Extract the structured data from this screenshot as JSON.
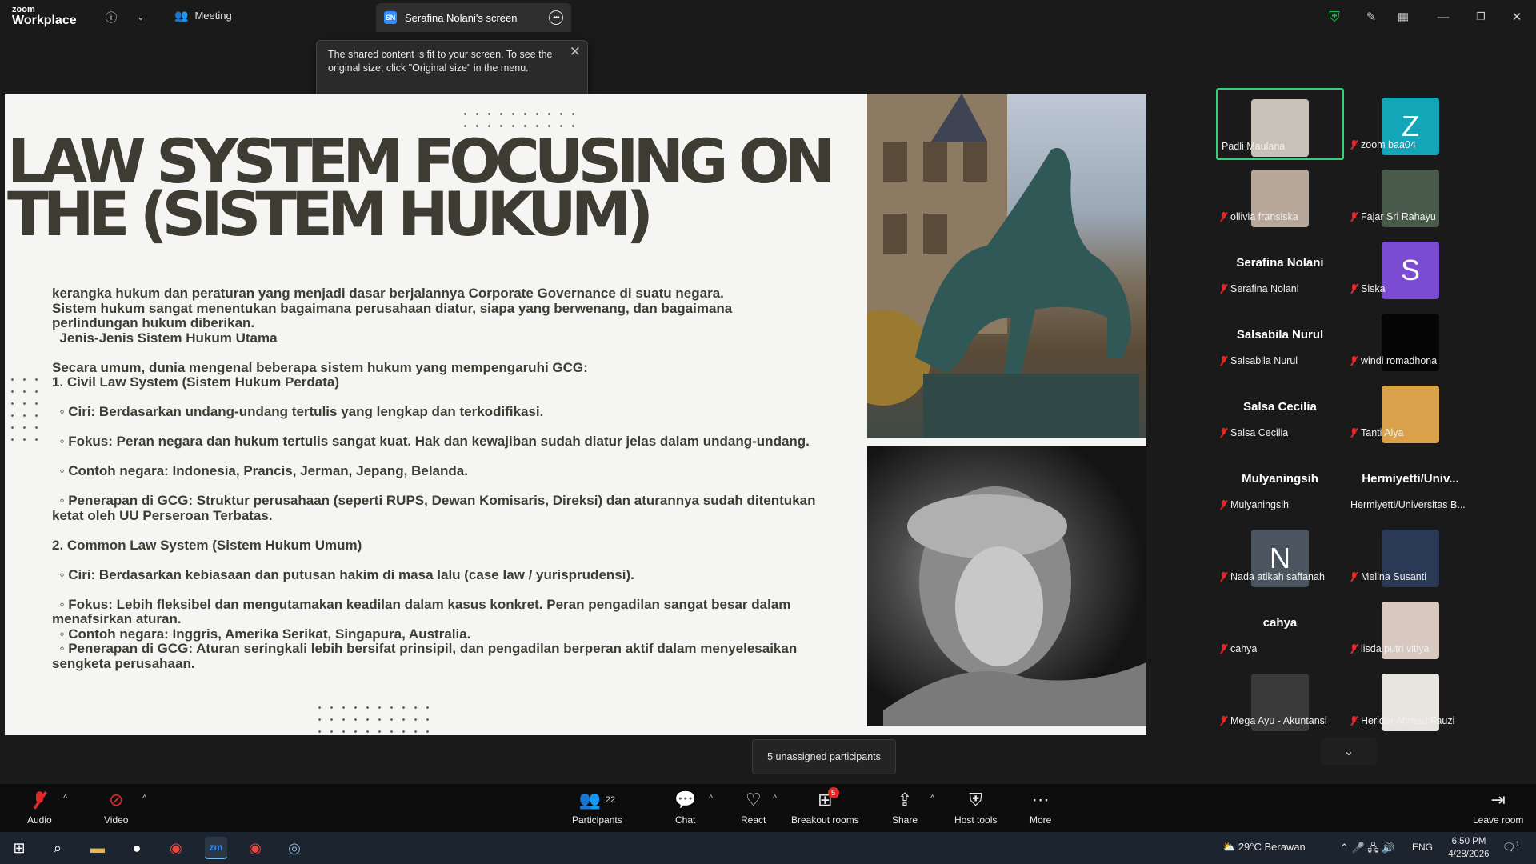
{
  "app": {
    "logo_line1": "zoom",
    "logo_line2": "Workplace",
    "meeting_tab": "Meeting",
    "share_tab": "Serafina Nolani's screen",
    "share_badge": "SN"
  },
  "tooltip": {
    "text": "The shared content is fit to your screen. To see the original size, click \"Original size\" in the menu."
  },
  "slide": {
    "title": "LAW SYSTEM FOCUSING ON THE (SISTEM HUKUM)",
    "lines": [
      "kerangka hukum dan peraturan yang menjadi dasar berjalannya Corporate Governance di suatu negara.",
      "Sistem hukum sangat menentukan bagaimana perusahaan diatur, siapa yang berwenang, dan bagaimana perlindungan hukum diberikan.",
      "  Jenis-Jenis Sistem Hukum Utama",
      "",
      "Secara umum, dunia mengenal beberapa sistem hukum yang mempengaruhi GCG:",
      "1. Civil Law System (Sistem Hukum Perdata)",
      "",
      "  ◦ Ciri: Berdasarkan undang-undang tertulis yang lengkap dan terkodifikasi.",
      "",
      "  ◦ Fokus: Peran negara dan hukum tertulis sangat kuat. Hak dan kewajiban sudah diatur jelas dalam undang-undang.",
      "",
      "  ◦ Contoh negara: Indonesia, Prancis, Jerman, Jepang, Belanda.",
      "",
      "  ◦ Penerapan di GCG: Struktur perusahaan (seperti RUPS, Dewan Komisaris, Direksi) dan aturannya sudah ditentukan ketat oleh UU Perseroan Terbatas.",
      "",
      "2. Common Law System (Sistem Hukum Umum)",
      "",
      "  ◦ Ciri: Berdasarkan kebiasaan dan putusan hakim di masa lalu (case law / yurisprudensi).",
      "",
      "  ◦ Fokus: Lebih fleksibel dan mengutamakan keadilan dalam kasus konkret. Peran pengadilan sangat besar dalam menafsirkan aturan.",
      "  ◦ Contoh negara: Inggris, Amerika Serikat, Singapura, Australia.",
      "  ◦ Penerapan di GCG: Aturan seringkali lebih bersifat prinsipil, dan pengadilan berperan aktif dalam menyelesaikan sengketa perusahaan."
    ]
  },
  "participants": [
    {
      "label": "Padli Maulana",
      "type": "photo",
      "color": "#c9c2b8",
      "active": true,
      "muted": false
    },
    {
      "label": "zoom baa04",
      "type": "letter",
      "letter": "Z",
      "color": "#13a6b8",
      "muted": true
    },
    {
      "label": "ollivia fransiska",
      "type": "photo",
      "color": "#b8a89a",
      "muted": true
    },
    {
      "label": "Fajar Sri Rahayu",
      "type": "photo",
      "color": "#4a5a4a",
      "muted": true
    },
    {
      "label": "Serafina Nolani",
      "type": "name",
      "bigname": "Serafina Nolani",
      "muted": true
    },
    {
      "label": "Siska",
      "type": "letter",
      "letter": "S",
      "color": "#7b4bd1",
      "muted": true
    },
    {
      "label": "Salsabila Nurul",
      "type": "name",
      "bigname": "Salsabila Nurul",
      "muted": true
    },
    {
      "label": "windi romadhona",
      "type": "photo",
      "color": "#050505",
      "muted": true
    },
    {
      "label": "Salsa Cecilia",
      "type": "name",
      "bigname": "Salsa Cecilia",
      "muted": true
    },
    {
      "label": "Tanti Alya",
      "type": "photo",
      "color": "#d9a14a",
      "muted": true
    },
    {
      "label": "Mulyaningsih",
      "type": "name",
      "bigname": "Mulyaningsih",
      "muted": true
    },
    {
      "label": "Hermiyetti/Universitas B...",
      "type": "name",
      "bigname": "Hermiyetti/Univ...",
      "muted": false
    },
    {
      "label": "Nada atikah saffanah",
      "type": "letter",
      "letter": "N",
      "color": "#4a5560",
      "muted": true
    },
    {
      "label": "Melina Susanti",
      "type": "photo",
      "color": "#2a3a55",
      "muted": true
    },
    {
      "label": "cahya",
      "type": "name",
      "bigname": "cahya",
      "muted": true
    },
    {
      "label": "lisda putri vitiya",
      "type": "photo",
      "color": "#d8c8c0",
      "muted": true
    },
    {
      "label": "Mega Ayu - Akuntansi",
      "type": "photo",
      "color": "#3a3a3a",
      "muted": true
    },
    {
      "label": "Heridar Ahmad Fauzi",
      "type": "photo",
      "color": "#e8e4e0",
      "muted": true
    }
  ],
  "unassigned": "5 unassigned participants",
  "toolbar": {
    "audio": "Audio",
    "video": "Video",
    "participants": "Participants",
    "participants_count": "22",
    "chat": "Chat",
    "react": "React",
    "breakout": "Breakout rooms",
    "breakout_badge": "5",
    "share": "Share",
    "host_tools": "Host tools",
    "more": "More",
    "leave": "Leave room"
  },
  "taskbar": {
    "weather": "29°C  Berawan",
    "lang": "ENG",
    "time": "6:50 PM",
    "date": "4/28/2026",
    "notif": "1"
  }
}
